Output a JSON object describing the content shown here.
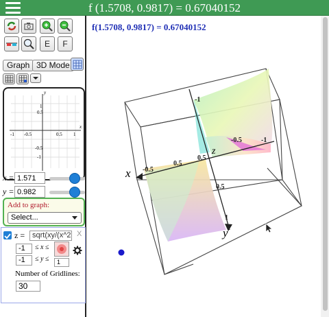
{
  "header": {
    "title": "f (1.5708, 0.9817) = 0.67040152",
    "bg": "#3f9a54"
  },
  "toolbar": {
    "row1": [
      {
        "icon": "reset-icon"
      },
      {
        "icon": "camera-icon"
      },
      {
        "icon": "zoom-in-icon"
      },
      {
        "icon": "zoom-out-icon"
      }
    ],
    "row2": [
      {
        "icon": "3d-glasses-icon"
      },
      {
        "icon": "search-icon"
      },
      {
        "label": "E"
      },
      {
        "label": "F"
      }
    ],
    "graph_label": "Graph",
    "mode_label": "3D Mode"
  },
  "mini_plot": {
    "ticks_x": [
      "-1",
      "-0.5",
      "0.5",
      "1"
    ],
    "ticks_y": [
      "1",
      "0.5",
      "-0.5",
      "-1"
    ],
    "x_label": "x",
    "y_label": "y"
  },
  "sliders": {
    "x": {
      "label": "x =",
      "value": "1.571",
      "position": 0.8
    },
    "y": {
      "label": "y =",
      "value": "0.982",
      "position": 0.8
    }
  },
  "add_graph": {
    "label": "Add to graph:",
    "selected": "Select..."
  },
  "equation": {
    "checked": true,
    "z_label": "z =",
    "formula": "sqrt(xy/(x^2",
    "close": "X",
    "x_min": "-1",
    "x_rel": "≤ x ≤",
    "y_min": "-1",
    "y_rel": "≤ y ≤",
    "y_max": "1",
    "gridlines_label": "Number of Gridlines:",
    "gridlines_value": "30"
  },
  "main": {
    "function_value": "f(1.5708, 0.9817) = 0.67040152",
    "axis_labels": {
      "x": "x",
      "y": "y",
      "z": "z"
    },
    "tick_labels": {
      "x_05": "0.5",
      "x_n05": "-0.5",
      "y_05": "0.5",
      "y_1": "1",
      "y_n1": "-1",
      "z_n1": "-1",
      "z_05": "-0.5",
      "z_n05": "0.5"
    },
    "accent": "#1f2fb5"
  }
}
